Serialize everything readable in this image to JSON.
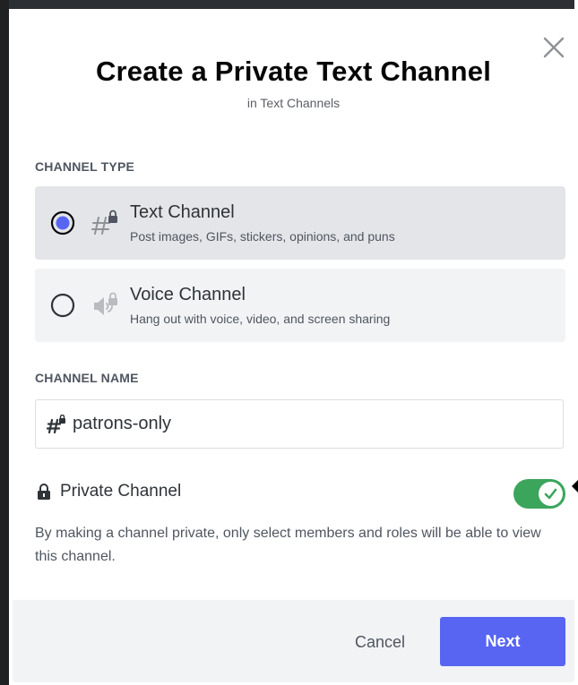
{
  "colors": {
    "accent": "#5865f2",
    "toggle_on": "#3ba55c",
    "selected_bg": "#e3e5e8",
    "option_bg": "#f2f3f5",
    "footer_bg": "#f2f3f5"
  },
  "modal": {
    "title": "Create a Private Text Channel",
    "subtitle": "in Text Channels",
    "close_icon": "close-icon"
  },
  "channel_type": {
    "label": "CHANNEL TYPE",
    "selected": "text",
    "options": [
      {
        "id": "text",
        "name": "Text Channel",
        "description": "Post images, GIFs, stickers, opinions, and puns",
        "icon": "text-channel-locked-icon",
        "selected": true
      },
      {
        "id": "voice",
        "name": "Voice Channel",
        "description": "Hang out with voice, video, and screen sharing",
        "icon": "voice-channel-locked-icon",
        "selected": false
      }
    ]
  },
  "channel_name": {
    "label": "CHANNEL NAME",
    "value": "patrons-only",
    "icon": "hash-locked-icon"
  },
  "private_channel": {
    "label": "Private Channel",
    "enabled": true,
    "description": "By making a channel private, only select members and roles will be able to view this channel.",
    "icon": "lock-icon"
  },
  "footer": {
    "cancel_label": "Cancel",
    "next_label": "Next"
  }
}
